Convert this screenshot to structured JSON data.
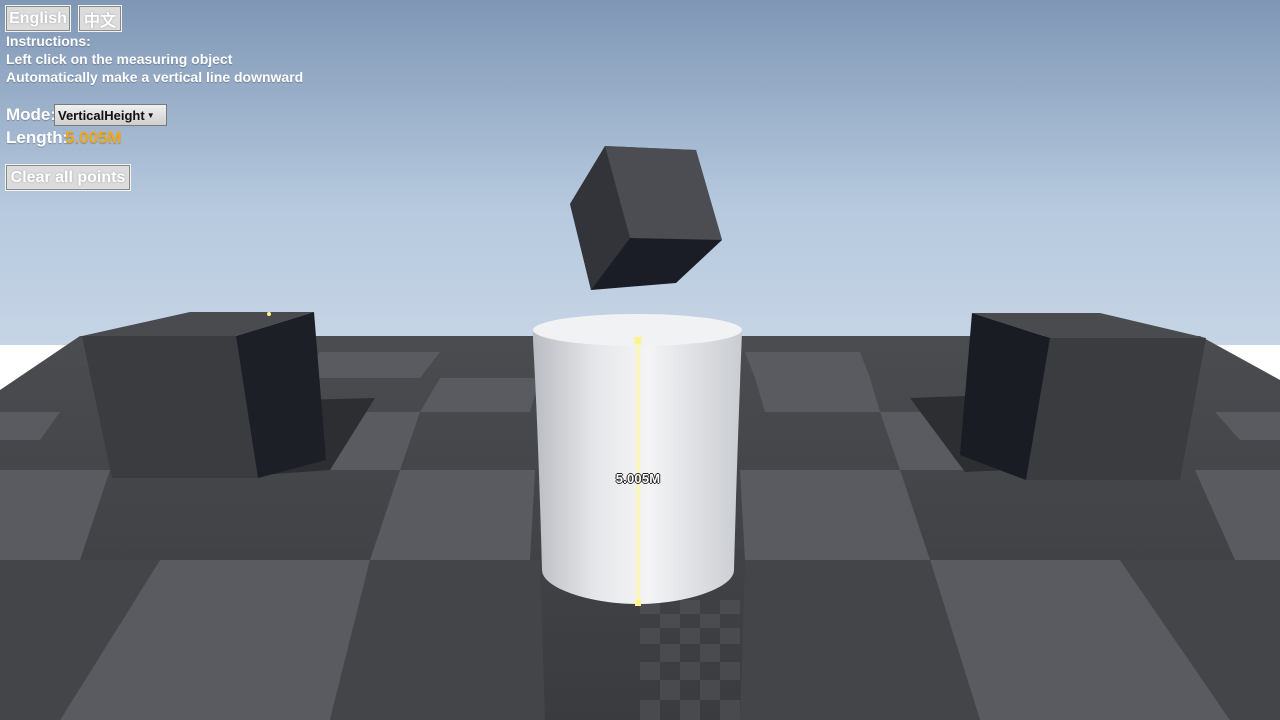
{
  "language": {
    "english_label": "English",
    "chinese_label": "中文"
  },
  "instructions": {
    "heading": "Instructions:",
    "line1": "Left click on the measuring object",
    "line2": "Automatically make a vertical line downward"
  },
  "mode": {
    "label": "Mode:",
    "selected": "VerticalHeight"
  },
  "length": {
    "label": "Length:",
    "value": "5.005M"
  },
  "clear_button": "Clear all points",
  "scene": {
    "measurement_label": "5.005M",
    "sky_top": "#7f97b5",
    "sky_horizon": "#c3d3e4",
    "accent_color": "#f0a81c",
    "measure_line_color": "#fff7a8"
  }
}
